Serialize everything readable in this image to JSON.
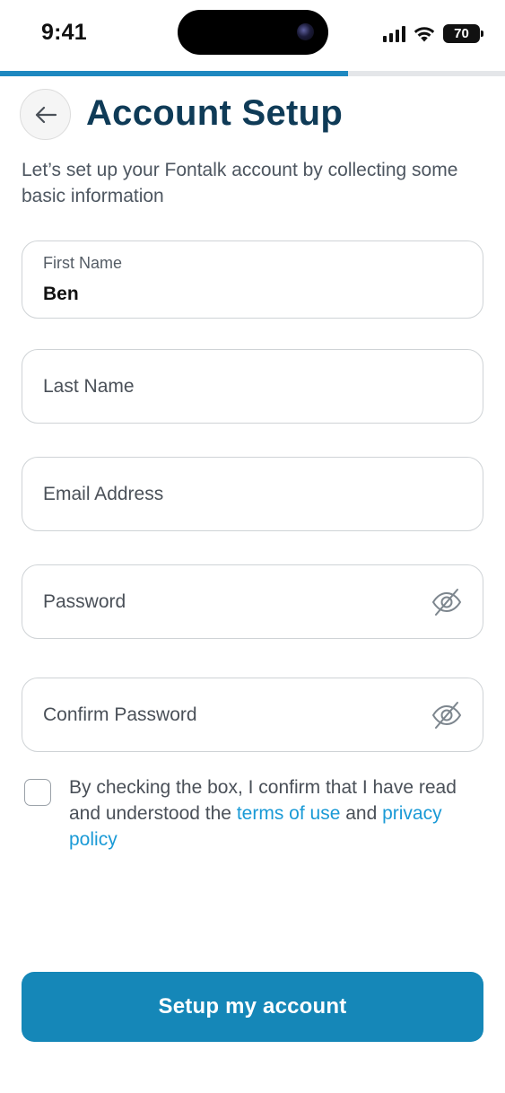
{
  "status_bar": {
    "time": "9:41",
    "battery_level": "70",
    "icons": [
      "signal-icon",
      "wifi-icon",
      "battery-icon"
    ]
  },
  "progress": {
    "fraction": 0.69
  },
  "header": {
    "back_icon": "arrow-left-icon",
    "title": "Account Setup",
    "subtitle": "Let’s set up your Fontalk account by collecting some basic information"
  },
  "form": {
    "first_name": {
      "label": "First Name",
      "value": "Ben"
    },
    "last_name": {
      "placeholder": "Last Name"
    },
    "email": {
      "placeholder": "Email Address"
    },
    "password": {
      "placeholder": "Password",
      "toggle_icon": "eye-off-icon"
    },
    "confirm_password": {
      "placeholder": "Confirm Password",
      "toggle_icon": "eye-off-icon"
    }
  },
  "consent": {
    "checked": false,
    "text_before": "By checking the box, I confirm that I have read and understood the ",
    "terms_link": "terms of use",
    "text_middle": " and ",
    "privacy_link": "privacy policy"
  },
  "cta": {
    "label": "Setup my account"
  },
  "colors": {
    "accent": "#1587b8",
    "title": "#0f3b57",
    "link": "#1a9ad6",
    "progress": "#1e88c0"
  }
}
